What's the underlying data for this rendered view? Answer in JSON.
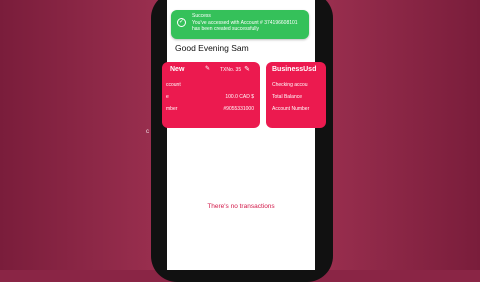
{
  "edge_text": "c E",
  "toast": {
    "title": "Success",
    "message": "You've accessed with Account # 374196608101 has been created successfully",
    "icon": "check-circle-icon",
    "color": "#35c15a"
  },
  "greeting": "Good Evening Sam",
  "cards": [
    {
      "name": "New",
      "txn": "TXNo. 35",
      "type_label": "ccount",
      "balance_label": "e",
      "balance_value": "100.0 CAD $",
      "number_label": "mber",
      "number_value": "#9055331000"
    },
    {
      "name": "BusinessUsd",
      "type_label": "Checking accou",
      "balance_label": "Total Balance",
      "number_label": "Account Number"
    }
  ],
  "card_color": "#ec1a4f",
  "empty_message": "There's no transactions"
}
